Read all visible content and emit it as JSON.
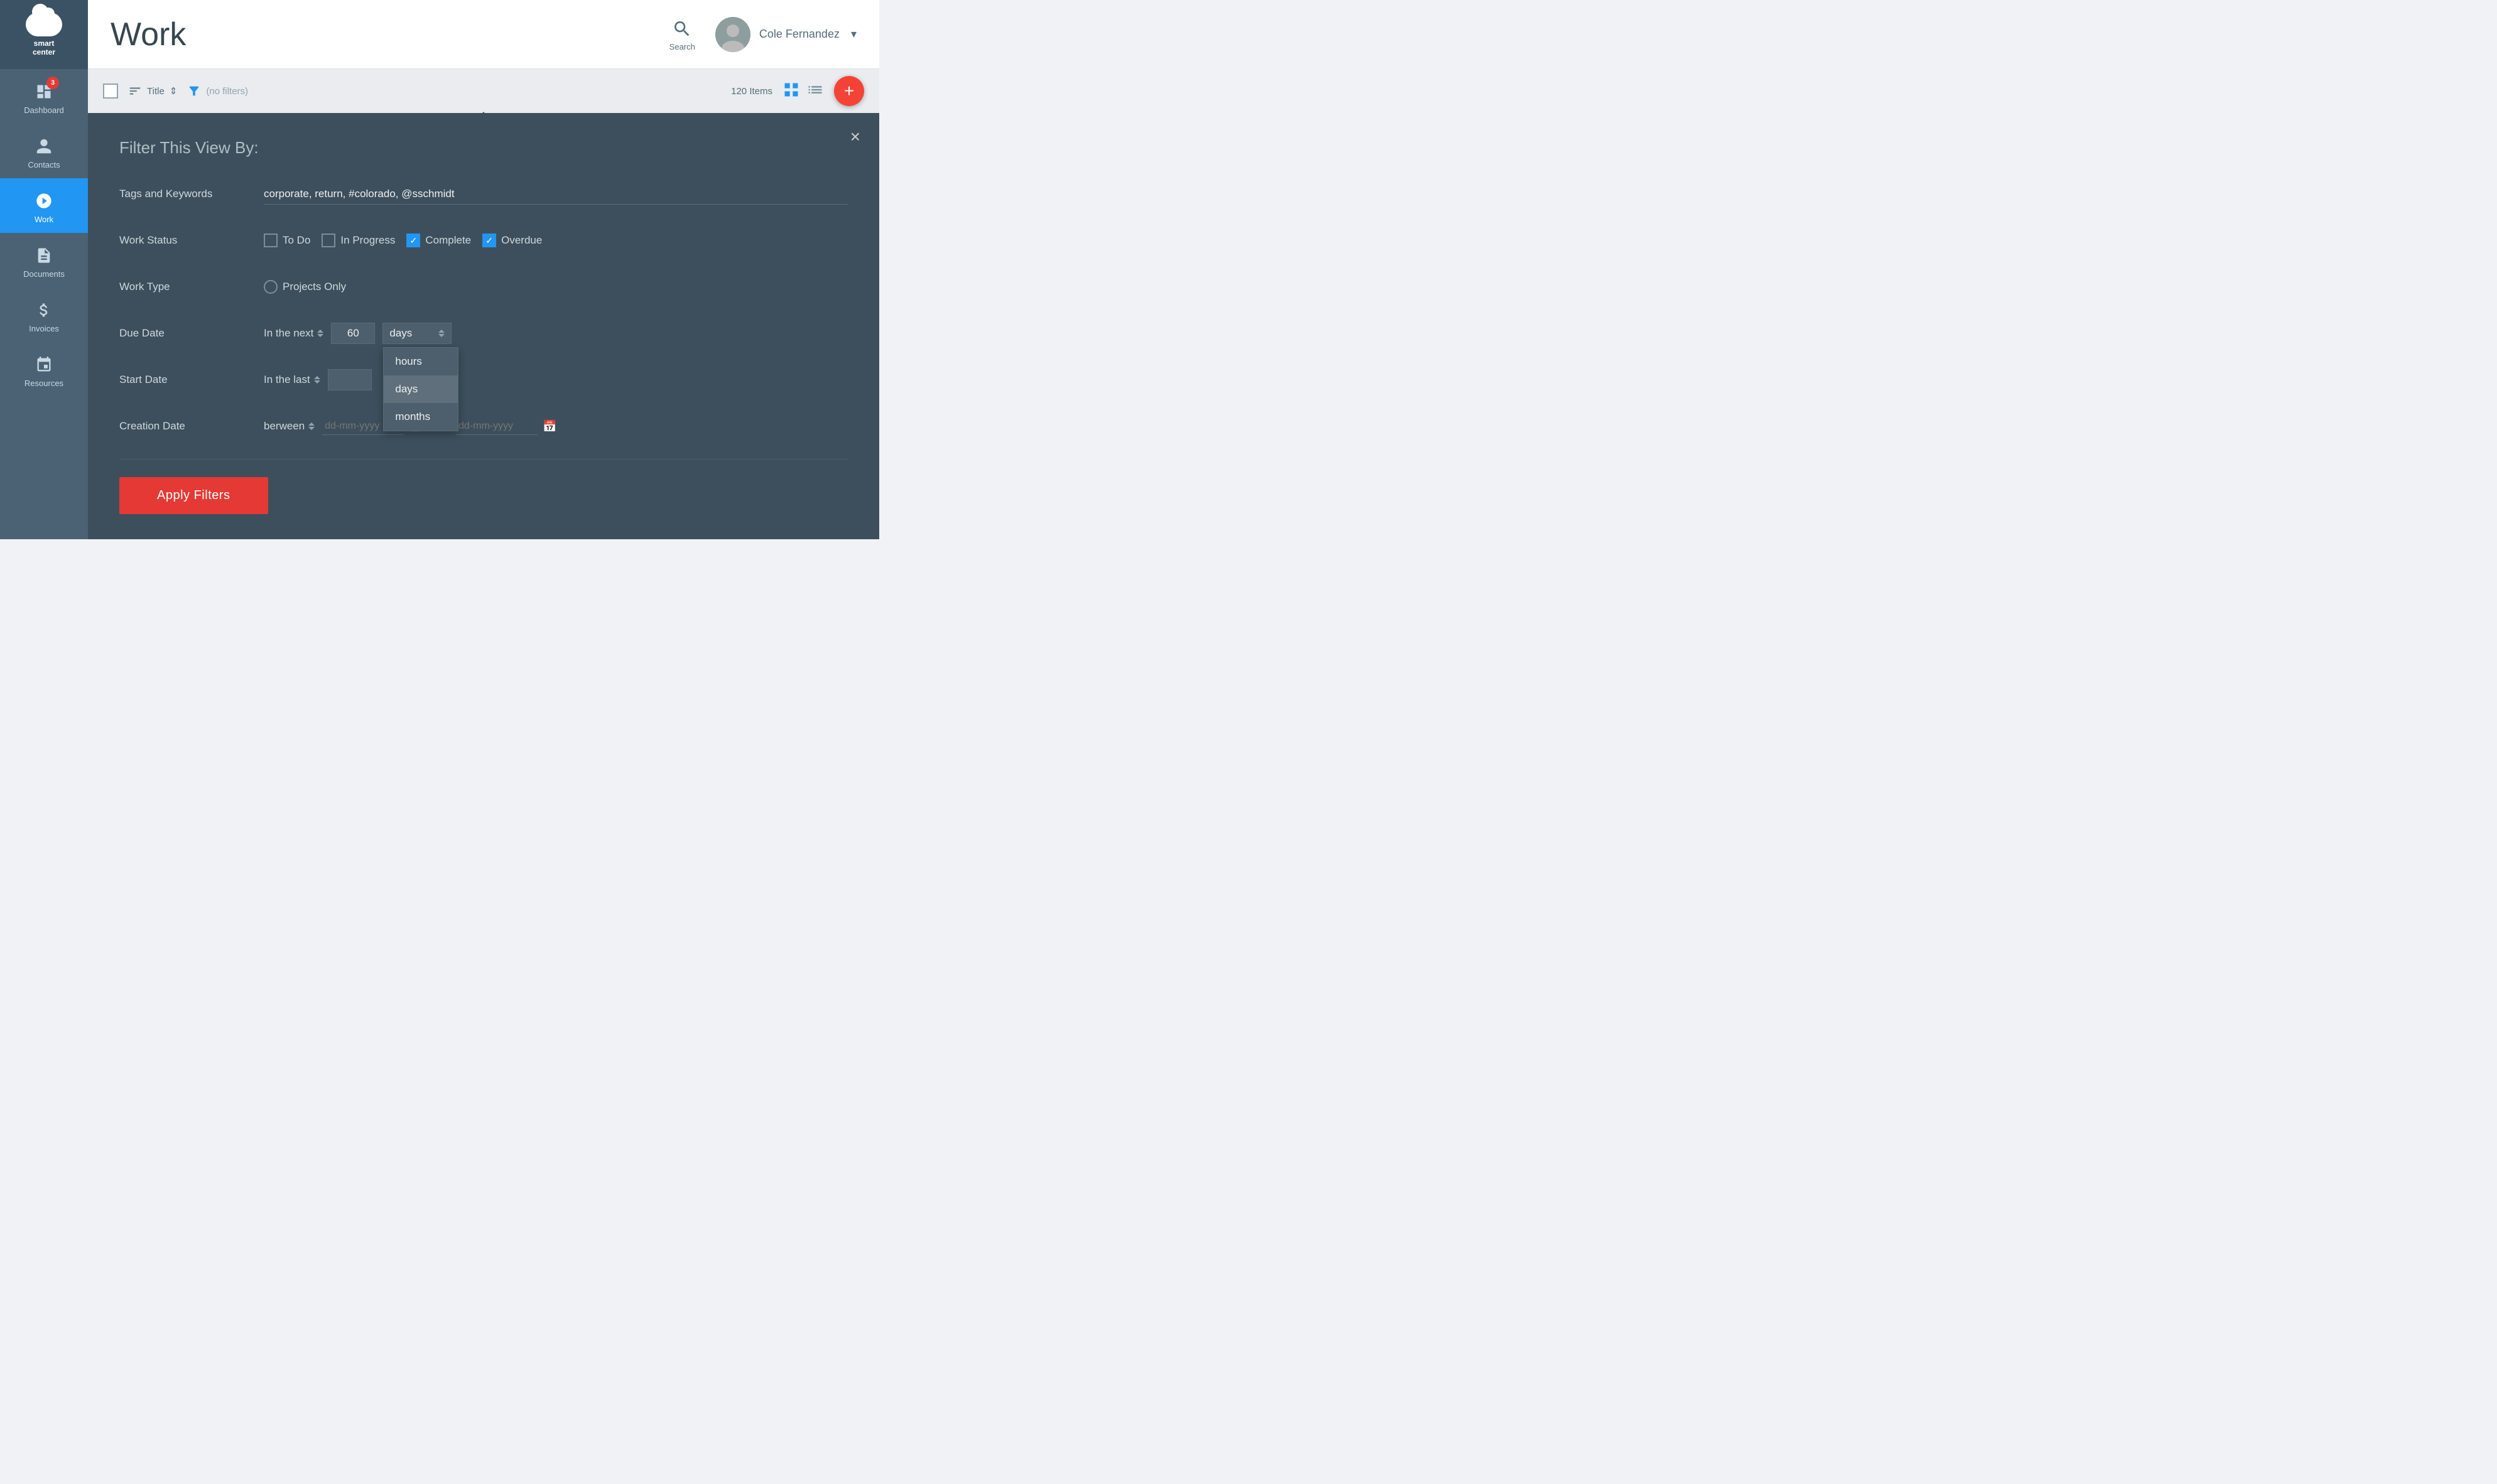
{
  "sidebar": {
    "logo": {
      "line1": "smart",
      "line2": "center"
    },
    "items": [
      {
        "id": "dashboard",
        "label": "Dashboard",
        "badge": 3,
        "active": false
      },
      {
        "id": "contacts",
        "label": "Contacts",
        "badge": null,
        "active": false
      },
      {
        "id": "work",
        "label": "Work",
        "badge": null,
        "active": true
      },
      {
        "id": "documents",
        "label": "Documents",
        "badge": null,
        "active": false
      },
      {
        "id": "invoices",
        "label": "Invoices",
        "badge": null,
        "active": false
      },
      {
        "id": "resources",
        "label": "Resources",
        "badge": null,
        "active": false
      }
    ]
  },
  "header": {
    "title": "Work",
    "search_label": "Search",
    "user_name": "Cole Fernandez"
  },
  "toolbar": {
    "sort_label": "Title",
    "filter_label": "(no filters)",
    "items_count": "120 Items"
  },
  "filter_panel": {
    "title": "Filter This View By:",
    "close_label": "×",
    "tags_label": "Tags and Keywords",
    "tags_value": "corporate, return, #colorado, @sschmidt",
    "tags_placeholder": "",
    "status_label": "Work Status",
    "statuses": [
      {
        "id": "todo",
        "label": "To Do",
        "checked": false
      },
      {
        "id": "inprogress",
        "label": "In Progress",
        "checked": false
      },
      {
        "id": "complete",
        "label": "Complete",
        "checked": true
      },
      {
        "id": "overdue",
        "label": "Overdue",
        "checked": true
      }
    ],
    "worktype_label": "Work Type",
    "worktype_option": "Projects Only",
    "duedate_label": "Due Date",
    "duedate_period": "In the next",
    "duedate_value": "60",
    "duedate_unit": "days",
    "duedate_units": [
      "hours",
      "days",
      "months"
    ],
    "startdate_label": "Start Date",
    "startdate_period": "In the last",
    "creation_label": "Creation Date",
    "creation_between": "berween",
    "creation_date1_placeholder": "dd-mm-yyyy",
    "creation_date2_placeholder": "dd-mm-yyyy",
    "apply_label": "Apply Filters"
  }
}
